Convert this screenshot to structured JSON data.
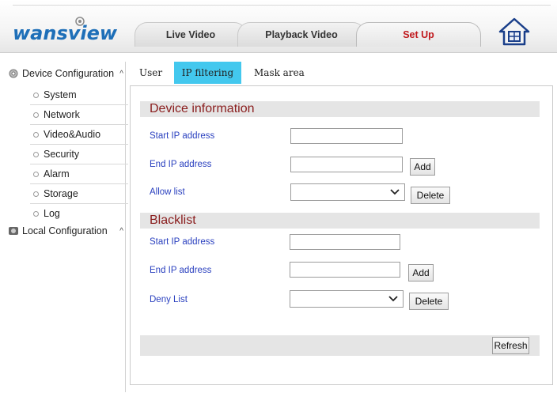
{
  "header": {
    "logo": {
      "text": "wansview"
    },
    "tabs": [
      {
        "label": "Live Video"
      },
      {
        "label": "Playback Video"
      },
      {
        "label": "Set Up"
      }
    ],
    "accent_color": "#c0181c"
  },
  "sidebar": {
    "device_config": {
      "label": "Device Configuration",
      "items": [
        {
          "label": "System"
        },
        {
          "label": "Network"
        },
        {
          "label": "Video&Audio"
        },
        {
          "label": "Security"
        },
        {
          "label": "Alarm"
        },
        {
          "label": "Storage"
        },
        {
          "label": "Log"
        }
      ]
    },
    "local_config": {
      "label": "Local Configuration"
    }
  },
  "subtabs": [
    {
      "label": "User"
    },
    {
      "label": "IP filtering"
    },
    {
      "label": "Mask area"
    }
  ],
  "device_info": {
    "title": "Device information",
    "start_label": "Start IP address",
    "end_label": "End IP address",
    "allow_label": "Allow list",
    "add_label": "Add",
    "delete_label": "Delete"
  },
  "blacklist": {
    "title": "Blacklist",
    "start_label": "Start IP address",
    "end_label": "End IP address",
    "deny_label": "Deny List",
    "add_label": "Add",
    "delete_label": "Delete"
  },
  "refresh_label": "Refresh",
  "colors": {
    "active_subtab": "#43c8ee",
    "section_title": "#8a1d1d",
    "field_label": "#2a40bf"
  }
}
